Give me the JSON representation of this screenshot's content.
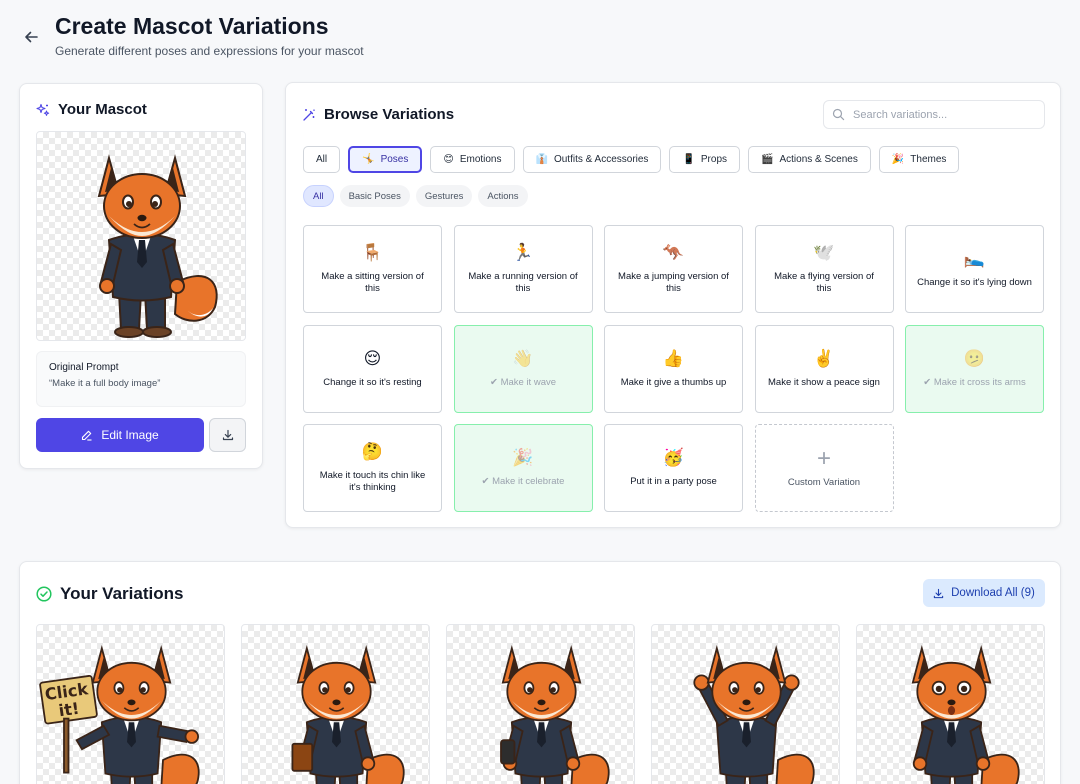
{
  "header": {
    "title": "Create Mascot Variations",
    "subtitle": "Generate different poses and expressions for your mascot"
  },
  "mascot": {
    "title": "Your Mascot",
    "prompt_label": "Original Prompt",
    "prompt_text": "“Make it a full body image”",
    "edit_label": "Edit Image"
  },
  "browse": {
    "title": "Browse Variations",
    "search_placeholder": "Search variations...",
    "categories": [
      {
        "label": "All",
        "icon": ""
      },
      {
        "label": "Poses",
        "icon": "🤸"
      },
      {
        "label": "Emotions",
        "icon": "😊"
      },
      {
        "label": "Outfits & Accessories",
        "icon": "👔"
      },
      {
        "label": "Props",
        "icon": "📱"
      },
      {
        "label": "Actions & Scenes",
        "icon": "🎬"
      },
      {
        "label": "Themes",
        "icon": "🎉"
      }
    ],
    "active_category": "Poses",
    "subcategories": [
      "All",
      "Basic Poses",
      "Gestures",
      "Actions"
    ],
    "active_subcategory": "All",
    "tiles": [
      {
        "icon": "🪑",
        "label": "Make a sitting version of this",
        "done": false
      },
      {
        "icon": "🏃",
        "label": "Make a running version of this",
        "done": false
      },
      {
        "icon": "🦘",
        "label": "Make a jumping version of this",
        "done": false
      },
      {
        "icon": "🕊️",
        "label": "Make a flying version of this",
        "done": false
      },
      {
        "icon": "🛌",
        "label": "Change it so it's lying down",
        "done": false
      },
      {
        "icon": "😌",
        "label": "Change it so it's resting",
        "done": false
      },
      {
        "icon": "👋",
        "label": "✔ Make it wave",
        "done": true
      },
      {
        "icon": "👍",
        "label": "Make it give a thumbs up",
        "done": false
      },
      {
        "icon": "✌️",
        "label": "Make it show a peace sign",
        "done": false
      },
      {
        "icon": "🫤",
        "label": "✔ Make it cross its arms",
        "done": true
      },
      {
        "icon": "🤔",
        "label": "Make it touch its chin like it's thinking",
        "done": false
      },
      {
        "icon": "🎉",
        "label": "✔ Make it celebrate",
        "done": true
      },
      {
        "icon": "🥳",
        "label": "Put it in a party pose",
        "done": false
      }
    ],
    "custom_label": "Custom Variation"
  },
  "variations": {
    "title": "Your Variations",
    "download_all_label": "Download All (9)",
    "items": [
      {
        "pose": "holding-sign",
        "sign_text": "Click it!"
      },
      {
        "pose": "holding-book"
      },
      {
        "pose": "holding-phone"
      },
      {
        "pose": "arms-up"
      },
      {
        "pose": "surprised"
      }
    ]
  },
  "colors": {
    "accent": "#4f46e5",
    "success": "#22c55e",
    "fox_orange": "#e8742a",
    "suit": "#2d3748"
  }
}
